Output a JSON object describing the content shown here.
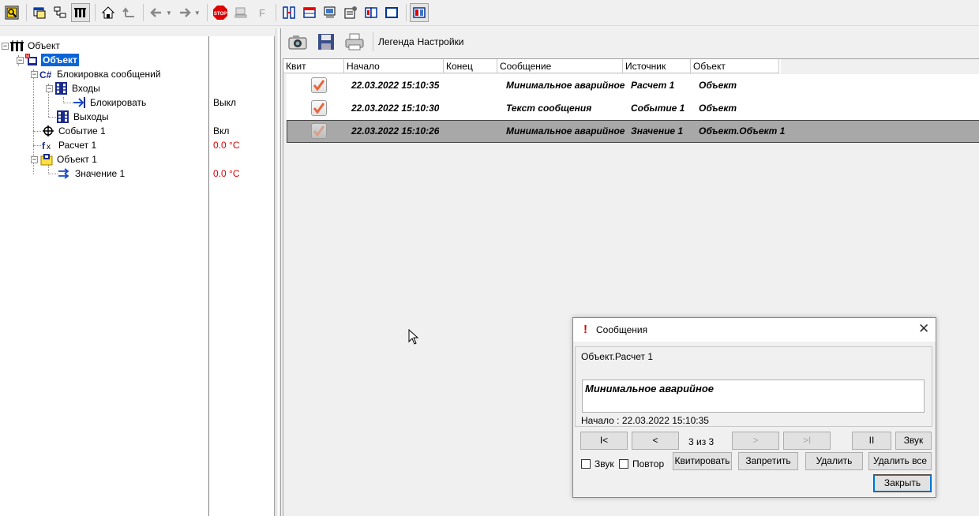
{
  "tree": {
    "nodes": [
      {
        "label": "Объект",
        "value": "",
        "icon": "object-root-icon"
      },
      {
        "label": "Объект",
        "value": "",
        "icon": "object-module-icon"
      },
      {
        "label": "Блокировка сообщений",
        "value": "",
        "icon": "csharp-icon"
      },
      {
        "label": "Входы",
        "value": "",
        "icon": "inputs-icon"
      },
      {
        "label": "Блокировать",
        "value": "Выкл",
        "icon": "arrow-link-icon"
      },
      {
        "label": "Выходы",
        "value": "",
        "icon": "outputs-icon"
      },
      {
        "label": "Событие 1",
        "value": "Вкл",
        "icon": "event-icon"
      },
      {
        "label": "Расчет 1",
        "value": "0.0 °C",
        "icon": "calc-icon"
      },
      {
        "label": "Объект 1",
        "value": "",
        "icon": "folder-object-icon"
      },
      {
        "label": "Значение 1",
        "value": "0.0 °C",
        "icon": "value-icon"
      }
    ]
  },
  "right_toolbar": {
    "legend_label": "Легенда",
    "settings_label": "Настройки"
  },
  "grid": {
    "columns": [
      "Квит",
      "Начало",
      "Конец",
      "Сообщение",
      "Источник",
      "Объект"
    ],
    "rows": [
      {
        "start": "22.03.2022 15:10:35",
        "end": "",
        "message": "Минимальное аварийное",
        "source": "Расчет 1",
        "object": "Объект"
      },
      {
        "start": "22.03.2022 15:10:30",
        "end": "",
        "message": "Текст сообщения",
        "source": "Событие 1",
        "object": "Объект"
      },
      {
        "start": "22.03.2022 15:10:26",
        "end": "",
        "message": "Минимальное аварийное",
        "source": "Значение 1",
        "object": "Объект.Объект 1"
      }
    ]
  },
  "dialog": {
    "title": "Сообщения",
    "source": "Объект.Расчет 1",
    "message": "Минимальное аварийное",
    "start": "Начало : 22.03.2022 15:10:35",
    "counter": "3 из   3",
    "buttons": {
      "first": "I<",
      "prev": "<",
      "next": ">",
      "last": ">I",
      "pause": "II",
      "sound": "Звук",
      "ack": "Квитировать",
      "forbid": "Запретить",
      "delete": "Удалить",
      "delete_all": "Удалить все",
      "close": "Закрыть"
    },
    "checkboxes": {
      "sound": "Звук",
      "repeat": "Повтор"
    }
  },
  "colors": {
    "selection": "#0a64d6",
    "value_red": "#e00000",
    "checkmark": "#e8643a"
  }
}
